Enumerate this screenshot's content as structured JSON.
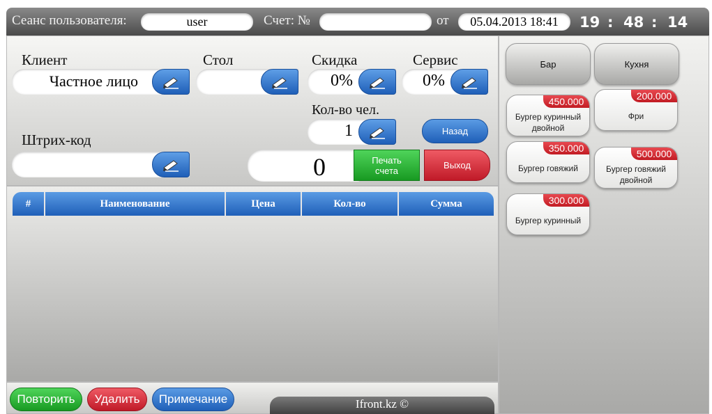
{
  "topbar": {
    "session_label": "Сеанс пользователя:",
    "user": "user",
    "account_label": "Счет: №",
    "account_number": "",
    "from_label": "от",
    "datetime": "05.04.2013 18:41",
    "clock_h": "19",
    "clock_m": "48",
    "clock_s": "14",
    "clock_sep": ":"
  },
  "form": {
    "client_label": "Клиент",
    "client_value": "Частное лицо",
    "table_label": "Стол",
    "table_value": "",
    "discount_label": "Скидка",
    "discount_value": "0%",
    "service_label": "Сервис",
    "service_value": "0%",
    "people_label": "Кол-во чел.",
    "people_value": "1",
    "barcode_label": "Штрих-код",
    "barcode_value": "",
    "total": "0",
    "back_label": "Назад",
    "print_label_1": "Печать",
    "print_label_2": "счета",
    "exit_label": "Выход"
  },
  "table": {
    "columns": [
      "#",
      "Наименование",
      "Цена",
      "Кол-во",
      "Сумма"
    ],
    "rows": []
  },
  "bottom": {
    "repeat_label": "Повторить",
    "delete_label": "Удалить",
    "note_label": "Примечание",
    "footer": "Ifront.kz ©"
  },
  "menu": {
    "categories": [
      "Бар",
      "Кухня"
    ],
    "items": [
      {
        "name": "Бургер куринный двойной",
        "price": "450.000"
      },
      {
        "name": "Фри",
        "price": "200.000"
      },
      {
        "name": "Бургер говяжий",
        "price": "350.000"
      },
      {
        "name": "Бургер говяжий двойной",
        "price": "500.000"
      },
      {
        "name": "Бургер куринный",
        "price": "300.000"
      }
    ]
  },
  "colors": {
    "accent_blue": "#2b6fcb",
    "accent_green": "#22a82c",
    "accent_red": "#d02432",
    "price_red": "#d2262e",
    "topbar_dark": "#4a4a4a"
  },
  "icons": [
    "pencil-icon"
  ]
}
